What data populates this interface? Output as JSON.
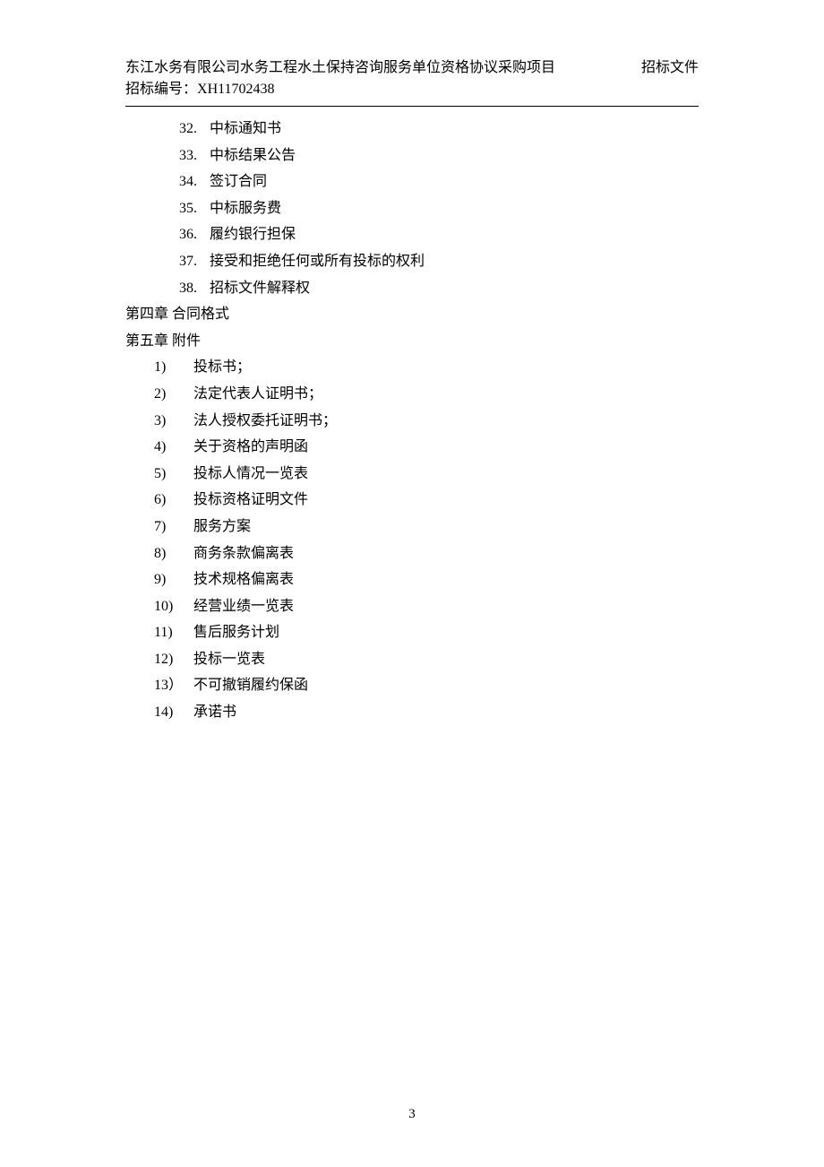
{
  "header": {
    "title_line1": "东江水务有限公司水务工程水土保持咨询服务单位资格协议采购项目",
    "title_line2_prefix": "招标编号：",
    "bid_number": "XH11702438",
    "doc_type": "招标文件"
  },
  "toc": {
    "numbered_items": [
      {
        "num": "32.",
        "text": "中标通知书"
      },
      {
        "num": "33.",
        "text": "中标结果公告"
      },
      {
        "num": "34.",
        "text": "签订合同"
      },
      {
        "num": "35.",
        "text": "中标服务费"
      },
      {
        "num": "36.",
        "text": "履约银行担保"
      },
      {
        "num": "37.",
        "text": "接受和拒绝任何或所有投标的权利"
      },
      {
        "num": "38.",
        "text": "招标文件解释权"
      }
    ],
    "chapter4": "第四章 合同格式",
    "chapter5": "第五章 附件",
    "paren_items_a": [
      {
        "num": "1)",
        "text": "投标书；"
      },
      {
        "num": "2)",
        "text": "法定代表人证明书；"
      },
      {
        "num": "3)",
        "text": "法人授权委托证明书；"
      },
      {
        "num": "4)",
        "text": "关于资格的声明函"
      },
      {
        "num": "5)",
        "text": "投标人情况一览表"
      },
      {
        "num": "6)",
        "text": "投标资格证明文件"
      },
      {
        "num": "7)",
        "text": "服务方案"
      },
      {
        "num": "8)",
        "text": "商务条款偏离表"
      }
    ],
    "paren_items_b": [
      {
        "num": "9)",
        "text": "技术规格偏离表"
      },
      {
        "num": "10)",
        "text": "经营业绩一览表"
      },
      {
        "num": "11)",
        "text": "售后服务计划"
      },
      {
        "num": "12)",
        "text": "投标一览表"
      },
      {
        "num": "13）",
        "text": "不可撤销履约保函"
      },
      {
        "num": "14)",
        "text": "承诺书"
      }
    ]
  },
  "page_number": "3"
}
